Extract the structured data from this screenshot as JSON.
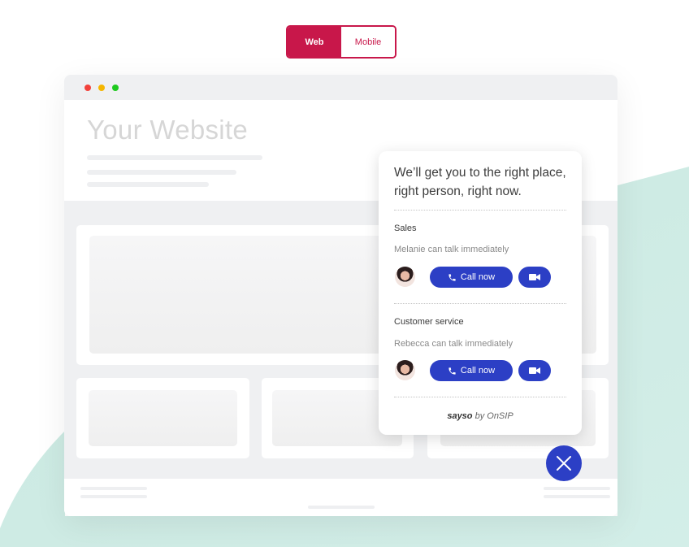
{
  "toggle": {
    "options": [
      "Web",
      "Mobile"
    ],
    "selected": "Web"
  },
  "colors": {
    "brand_red": "#c8174a",
    "action_blue": "#2c3fc5",
    "teal_background": "#d0ece6"
  },
  "browser": {
    "window_dots": [
      "close",
      "minimize",
      "maximize"
    ],
    "site_title": "Your Website"
  },
  "widget": {
    "headline": "We’ll get you to the right place, right person, right now.",
    "departments": [
      {
        "name": "Sales",
        "availability": "Melanie can talk immediately",
        "call_label": "Call now",
        "call_icon": "phone-icon",
        "video_icon": "video-camera-icon"
      },
      {
        "name": "Customer service",
        "availability": "Rebecca can talk immediately",
        "call_label": "Call now",
        "call_icon": "phone-icon",
        "video_icon": "video-camera-icon"
      }
    ],
    "brand_name": "sayso",
    "brand_suffix": " by OnSIP",
    "close_icon": "close-icon"
  }
}
